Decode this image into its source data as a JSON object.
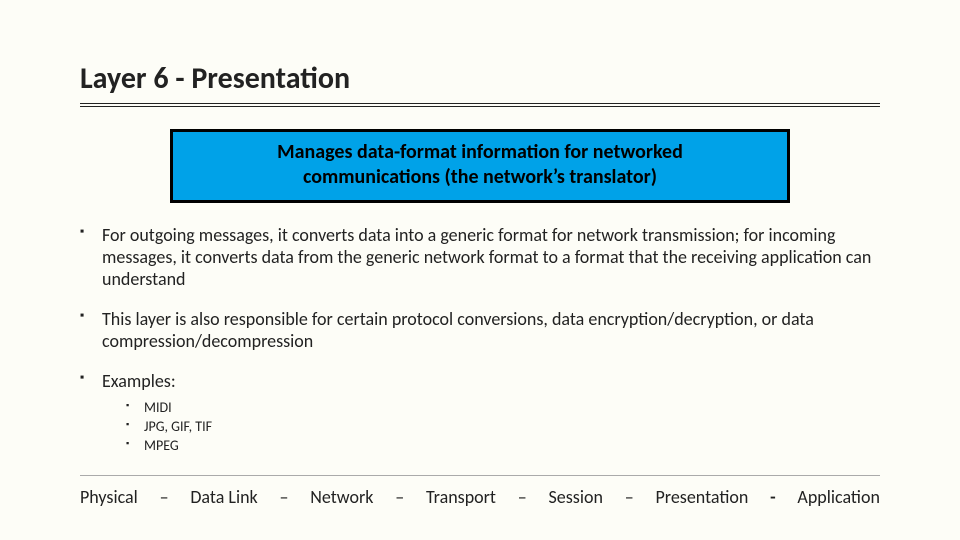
{
  "title": "Layer 6 - Presentation",
  "summary_line1": "Manages data-format information for networked",
  "summary_line2": "communications (the network’s translator)",
  "bullets": [
    "For outgoing messages, it converts data into a generic format for network transmission; for incoming messages, it converts data from the generic network format to a format that the receiving application can understand",
    "This layer is also responsible for certain protocol conversions, data encryption/decryption, or data compression/decompression",
    "Examples:"
  ],
  "examples": [
    "MIDI",
    "JPG, GIF, TIF",
    "MPEG"
  ],
  "footer": {
    "items": [
      "Physical",
      "Data Link",
      "Network",
      "Transport",
      "Session",
      "Presentation",
      "Application"
    ],
    "sep_dash": "–",
    "sep_dot": "-"
  }
}
